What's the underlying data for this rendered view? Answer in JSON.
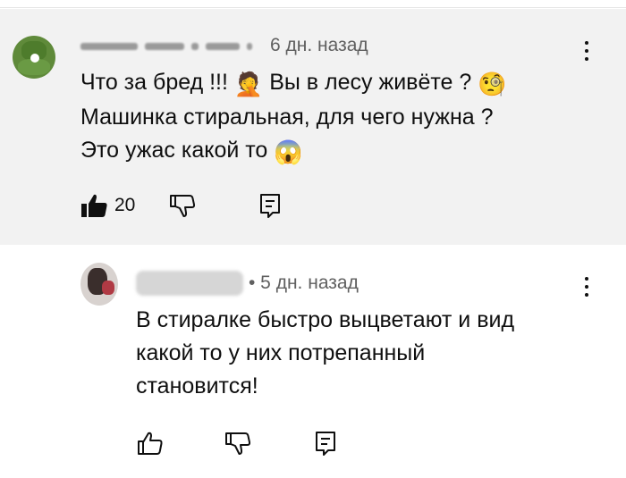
{
  "comments": [
    {
      "author": "",
      "time": "6 дн. назад",
      "lines": [
        "Что за бред !!! ",
        "Вы в лесу живёте ? ",
        "Машинка стиральная, для чего нужна ?",
        "Это ужас какой то "
      ],
      "emoji": [
        "🤦",
        "🧐",
        "😱"
      ],
      "likes": "20",
      "liked": true
    },
    {
      "author": "",
      "time": "• 5 дн. назад",
      "lines": [
        "В стиралке быстро выцветают и вид",
        "какой то у них потрепанный",
        "становится!"
      ]
    }
  ],
  "icons": {
    "like": "thumbs-up-icon",
    "dislike": "thumbs-down-icon",
    "reply": "reply-icon",
    "menu": "more-vert-icon"
  },
  "colors": {
    "highlight_bg": "#f2f2f2",
    "meta_text": "#606060",
    "text": "#0f0f0f"
  }
}
